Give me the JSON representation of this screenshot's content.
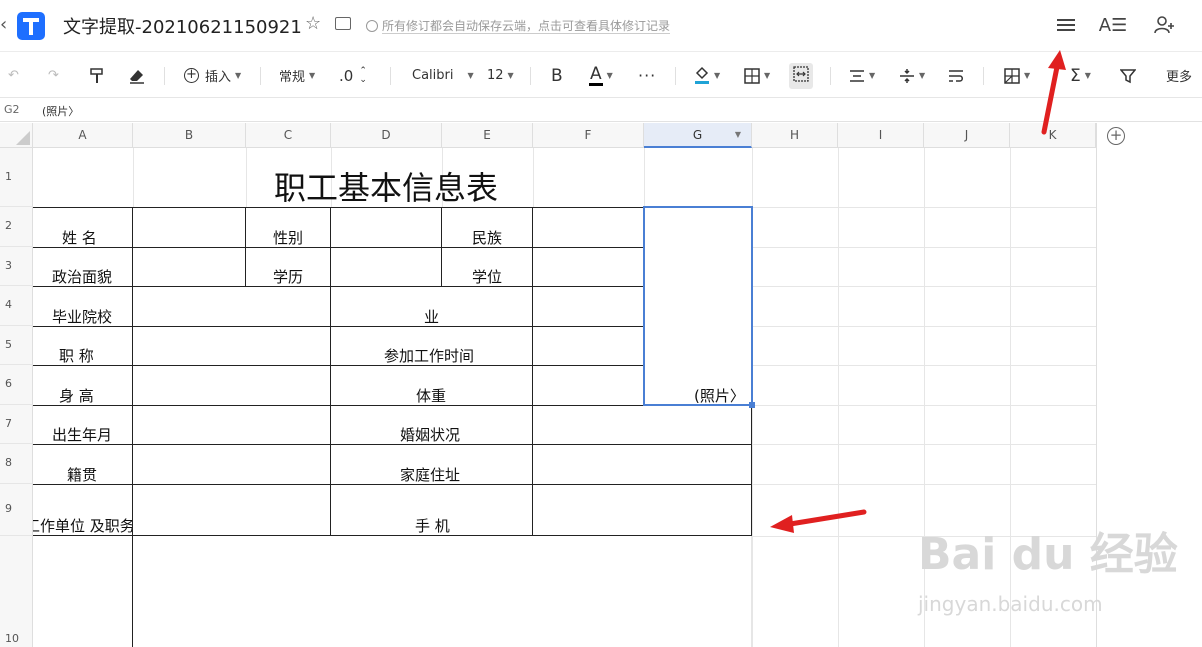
{
  "app": {
    "doc_title": "文字提取-20210621150921",
    "save_info": "所有修订都会自动保存云端，点击可查看具体修订记录",
    "icons": {
      "back": "chevron-left-icon",
      "logo": "tencent-docs-logo",
      "star": "star-icon",
      "folder": "move-folder-icon",
      "menu": "hamburger-menu-icon",
      "font": "font-style-icon",
      "add_user": "add-collaborator-icon"
    }
  },
  "toolbar": {
    "insert": "插入",
    "format": "常规",
    "decimal": ".0",
    "font": "Calibri",
    "font_size": "12",
    "bold": "B",
    "font_color": "A",
    "more_dots": "···",
    "sum": "Σ",
    "more": "更多",
    "font_color_hex": "#000000",
    "fill_color_hex": "#1fa3d6"
  },
  "formula_bar": {
    "cell_ref": "G2",
    "content": "(照片〉"
  },
  "columns": [
    "A",
    "B",
    "C",
    "D",
    "E",
    "F",
    "G",
    "H",
    "I",
    "J",
    "K"
  ],
  "rows": [
    "1",
    "2",
    "3",
    "4",
    "5",
    "6",
    "7",
    "8",
    "9",
    "10"
  ],
  "sheet": {
    "title": "职工基本信息表",
    "name_label": "姓  名",
    "gender_label": "性别",
    "ethnicity_label": "民族",
    "political_label": "政治面貌",
    "education_label": "学历",
    "degree_label": "学位",
    "school_label": "毕业院校",
    "major_label": "业",
    "jobtitle_label": "职    称",
    "workstart_label": "参加工作时间",
    "height_label": "身    高",
    "weight_label": "体重",
    "birth_label": "出生年月",
    "marital_label": "婚姻状况",
    "native_label": "籍贯",
    "address_label": "家庭住址",
    "workunit_label": "工作单位 及职务",
    "phone_label": "手 机",
    "photo_label": "(照片〉"
  },
  "watermark": {
    "brand": "Bai du 经验",
    "url": "jingyan.baidu.com"
  },
  "colors": {
    "accent": "#4a7fd4",
    "annotation_red": "#e02020"
  }
}
